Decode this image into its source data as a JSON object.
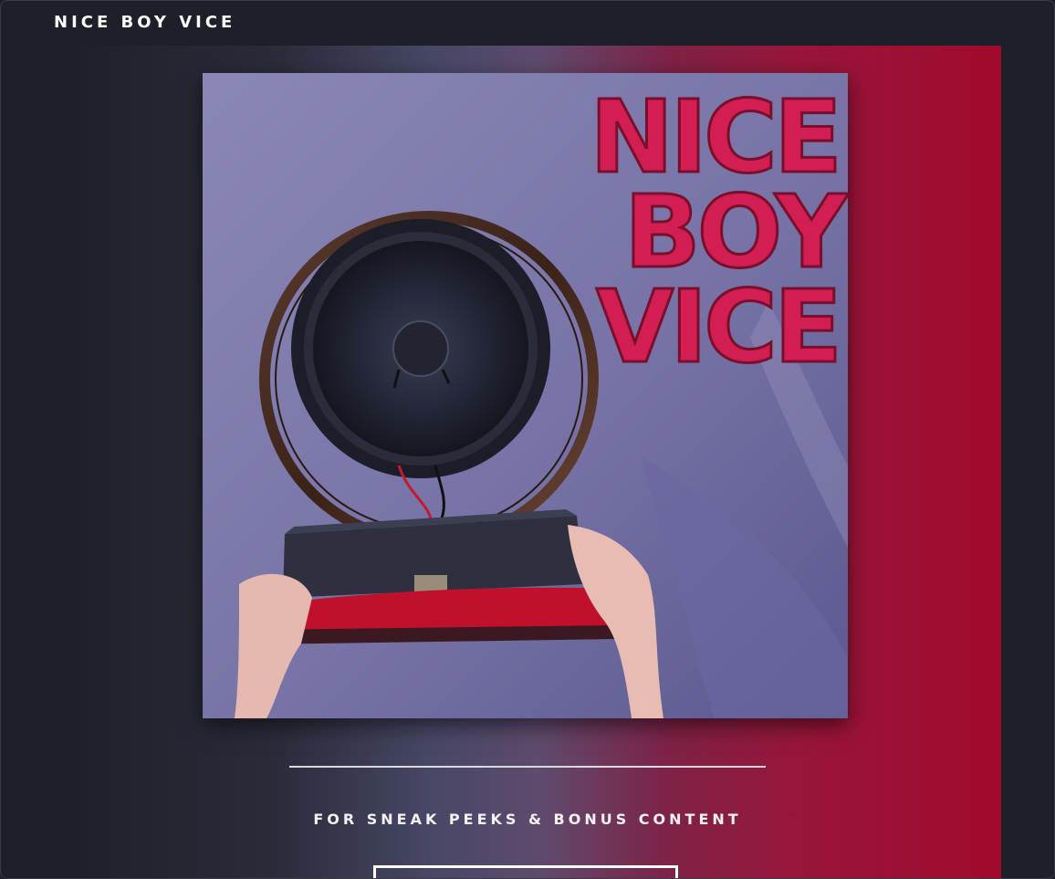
{
  "header": {
    "site_title": "NICE BOY VICE"
  },
  "hero": {
    "cover_art": {
      "description_icon": "album-cover-speaker",
      "title_lines": [
        "NICE",
        "BOY",
        "VICE"
      ],
      "title_color": "#d21e52"
    },
    "cta_text": "FOR SNEAK PEEKS & BONUS CONTENT",
    "cta_button_label": ""
  },
  "colors": {
    "background": "#1e2029",
    "accent": "#a00a2c",
    "text": "#ffffff"
  }
}
